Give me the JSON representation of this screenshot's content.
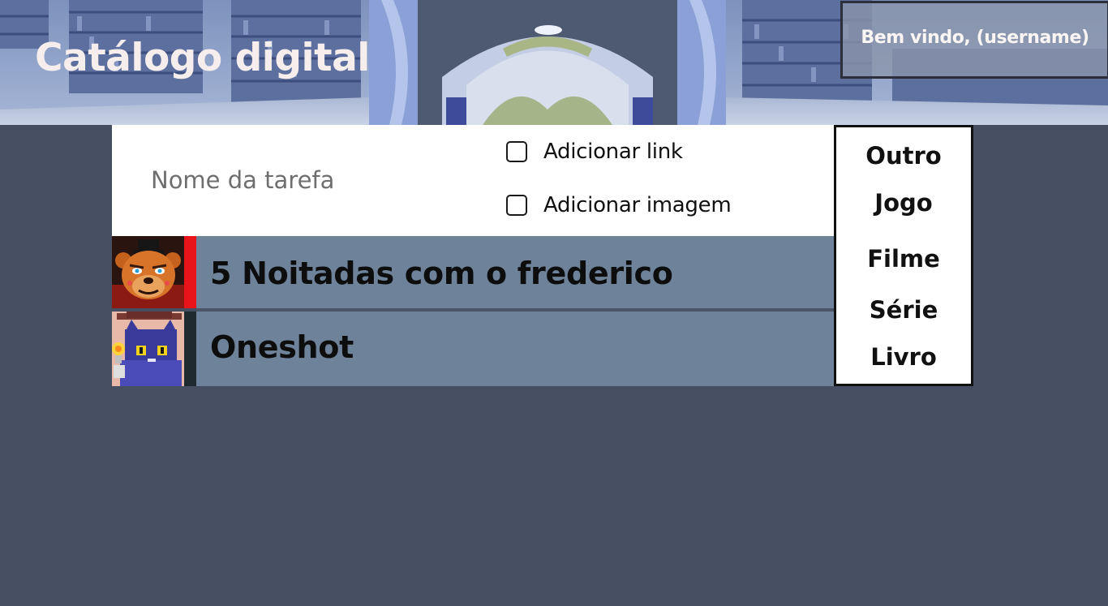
{
  "header": {
    "title": "Catálogo digital",
    "welcome": "Bem vindo, (username)"
  },
  "form": {
    "task_placeholder": "Nome da tarefa",
    "options": [
      {
        "label": "Adicionar link",
        "checked": false
      },
      {
        "label": "Adicionar imagem",
        "checked": false
      }
    ]
  },
  "categories": [
    "Outro",
    "Jogo",
    "Filme",
    "Série",
    "Livro"
  ],
  "items": [
    {
      "title": "5 Noitadas com o frederico",
      "accent_color": "#e8141a",
      "thumbnail_icon": "animatronic-bear-icon"
    },
    {
      "title": "Oneshot",
      "accent_color": "#1e2a30",
      "thumbnail_icon": "cat-child-with-lightbulb-icon"
    }
  ],
  "colors": {
    "page_background": "#454f61",
    "row_background": "#6e839a",
    "form_background": "#ffffff"
  }
}
